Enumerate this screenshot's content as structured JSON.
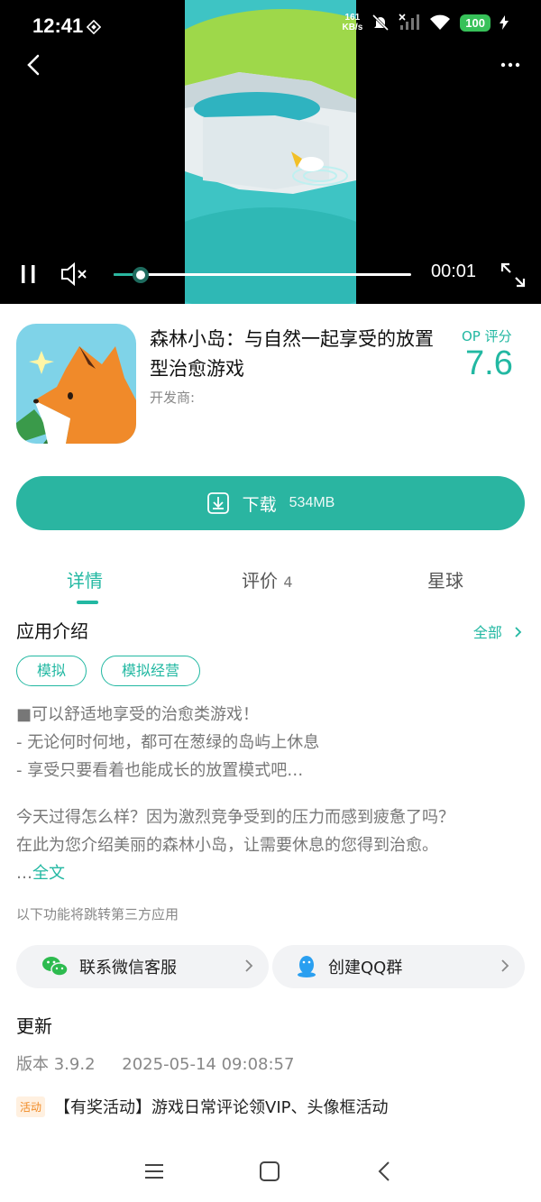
{
  "status_bar": {
    "time": "12:41",
    "net_speed_value": "161",
    "net_speed_unit": "KB/s",
    "battery": "100"
  },
  "video": {
    "current_time": "00:01",
    "progress_fraction": 0.09
  },
  "app": {
    "title": "森林小岛：与自然一起享受的放置型治愈游戏",
    "developer_label": "开发商:",
    "rating_label": "OP 评分",
    "rating_value": "7.6"
  },
  "download": {
    "label": "下载",
    "size": "534MB"
  },
  "tabs": [
    {
      "label": "详情",
      "count": ""
    },
    {
      "label": "评价",
      "count": "4"
    },
    {
      "label": "星球",
      "count": ""
    }
  ],
  "intro": {
    "title": "应用介绍",
    "all_label": "全部",
    "tags": [
      "模拟",
      "模拟经营"
    ],
    "lines": [
      "■可以舒适地享受的治愈类游戏！",
      "- 无论何时何地，都可在葱绿的岛屿上休息",
      "- 享受只要看着也能成长的放置模式吧…"
    ],
    "para_line1": "今天过得怎么样？因为激烈竞争受到的压力而感到疲惫了吗？",
    "para_line2": "在此为您介绍美丽的森林小岛，让需要休息的您得到治愈。",
    "ellipsis": "…",
    "fulltext_label": "全文"
  },
  "third_party_note": "以下功能将跳转第三方应用",
  "contacts": {
    "wechat_label": "联系微信客服",
    "qq_label": "创建QQ群"
  },
  "update": {
    "title": "更新",
    "version": "版本 3.9.2",
    "date": "2025-05-14 09:08:57"
  },
  "activity": {
    "badge": "活动",
    "text": "【有奖活动】游戏日常评论领VIP、头像框活动"
  },
  "colors": {
    "accent": "#22b8a2",
    "download_bg": "#2ab5a1",
    "activity_badge": "#f08a24"
  }
}
